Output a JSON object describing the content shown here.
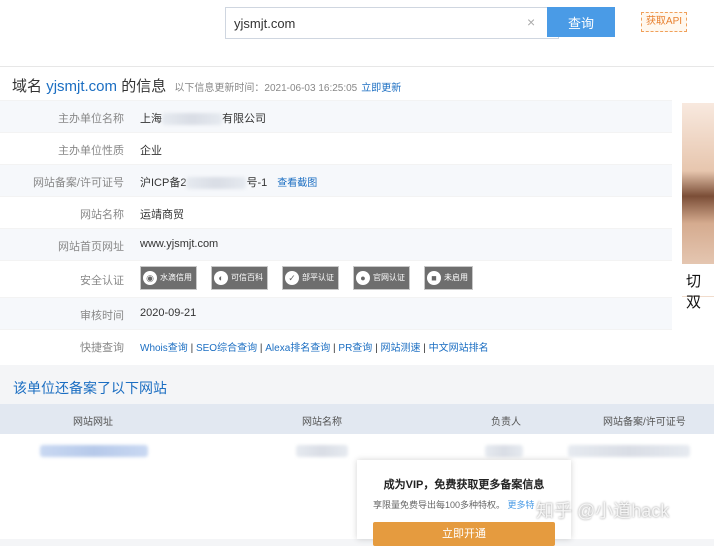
{
  "search": {
    "value": "yjsmjt.com",
    "button": "查询",
    "clear_icon": "×"
  },
  "api_button": "获取API",
  "info": {
    "title_prefix": "域名",
    "domain": "yjsmjt.com",
    "title_suffix": "的信息",
    "meta": "以下信息更新时间：2021-06-03 16:25:05",
    "update_link": "立即更新",
    "rows": [
      {
        "label": "主办单位名称",
        "value_start": "上海",
        "value_end": "有限公司"
      },
      {
        "label": "主办单位性质",
        "value": "企业"
      },
      {
        "label": "网站备案/许可证号",
        "value_start": "沪ICP备2",
        "value_end": "号-1",
        "link": "查看截图"
      },
      {
        "label": "网站名称",
        "value": "运靖商贸"
      },
      {
        "label": "网站首页网址",
        "value": "www.yjsmjt.com"
      },
      {
        "label": "安全认证",
        "badges": [
          "水滴信用",
          "可信百科",
          "部平认证",
          "官网认证",
          "未启用"
        ]
      },
      {
        "label": "审核时间",
        "value": "2020-09-21"
      },
      {
        "label": "快捷查询",
        "links": [
          "Whois查询",
          "SEO综合查询",
          "Alexa排名查询",
          "PR查询",
          "网站测速",
          "中文网站排名"
        ]
      }
    ]
  },
  "photo_caption": "切双",
  "section_title": "该单位还备案了以下网站",
  "table": {
    "headers": [
      "网站网址",
      "网站名称",
      "负责人",
      "网站备案/许可证号"
    ]
  },
  "vip": {
    "title": "成为VIP，免费获取更多备案信息",
    "subtitle": "享限量免费导出每100多种特权。",
    "more": "更多特",
    "button": "立即开通"
  },
  "watermark": "知乎 @小道hack"
}
